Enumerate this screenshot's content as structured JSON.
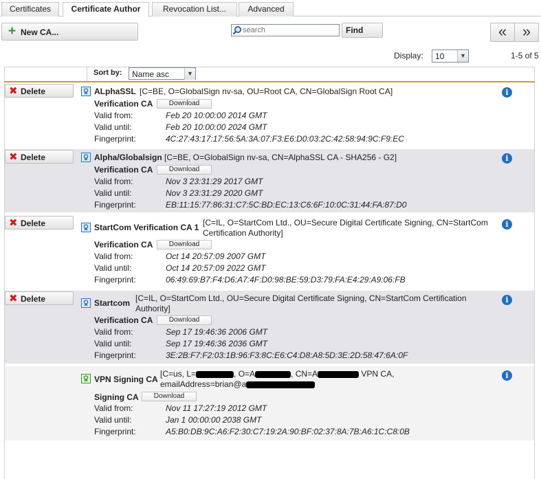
{
  "tabs": [
    {
      "label": "Certificates",
      "active": false
    },
    {
      "label": "Certificate Author",
      "active": true
    },
    {
      "label": "Revocation List...",
      "active": false
    },
    {
      "label": "Advanced",
      "active": false
    }
  ],
  "toolbar": {
    "new_ca_label": "New CA...",
    "search_placeholder": "search",
    "find_label": "Find",
    "prev_label": "«",
    "next_label": "»",
    "display_label": "Display:",
    "display_value": "10",
    "range_label": "1-5 of 5"
  },
  "sort": {
    "label": "Sort by:",
    "value": "Name asc"
  },
  "field_labels": {
    "valid_from": "Valid from:",
    "valid_until": "Valid until:",
    "fingerprint": "Fingerprint:"
  },
  "delete_label": "Delete",
  "download_label": "Download",
  "info_glyph": "i",
  "colors": {
    "accent_line": "#d3963a",
    "delete_red": "#cc1f1f",
    "info_blue": "#1f6fc4",
    "row_shade": "#e4e4e9"
  },
  "certificates": [
    {
      "name": "ALphaSSL",
      "dn": "[C=BE, O=GlobalSign nv-sa, OU=Root CA, CN=GlobalSign Root CA]",
      "type": "Verification CA",
      "valid_from": "Feb 20 10:00:00 2014 GMT",
      "valid_until": "Feb 20 10:00:00 2024 GMT",
      "fingerprint": "4C:27:43:17:17:56:5A:3A:07:F3:E6:D0:03:2C:42:58:94:9C:F9:EC",
      "deletable": true,
      "icon": "certificate-icon"
    },
    {
      "name": "Alpha/Globalsign",
      "dn": "[C=BE, O=GlobalSign nv-sa, CN=AlphaSSL CA - SHA256 - G2]",
      "type": "Verification CA",
      "valid_from": "Nov 3 23:31:29 2017 GMT",
      "valid_until": "Nov 3 23:31:29 2020 GMT",
      "fingerprint": "EB:11:15:77:86:31:C7:5C:BD:EC:13:C6:6F:10:0C:31:44:FA:87:D0",
      "deletable": true,
      "icon": "certificate-icon"
    },
    {
      "name": "StartCom Verification CA 1",
      "dn": "[C=IL, O=StartCom Ltd., OU=Secure Digital Certificate Signing, CN=StartCom Certification Authority]",
      "type": "Verification CA",
      "valid_from": "Oct 14 20:57:09 2007 GMT",
      "valid_until": "Oct 14 20:57:09 2022 GMT",
      "fingerprint": "06:49:69:B7:F4:D6:A7:4F:D0:98:BE:59:D3:79:FA:E4:29:A9:06:FB",
      "deletable": true,
      "icon": "certificate-icon"
    },
    {
      "name": "Startcom",
      "dn": "[C=IL, O=StartCom Ltd., OU=Secure Digital Certificate Signing, CN=StartCom Certification Authority]",
      "type": "Verification CA",
      "valid_from": "Sep 17 19:46:36 2006 GMT",
      "valid_until": "Sep 17 19:46:36 2036 GMT",
      "fingerprint": "3E:2B:F7:F2:03:1B:96:F3:8C:E6:C4:D8:A8:5D:3E:2D:58:47:6A:0F",
      "deletable": true,
      "icon": "certificate-icon"
    },
    {
      "name": "VPN Signing CA",
      "dn_line1_a": "[C=us, L=",
      "dn_line1_b": ", O=A",
      "dn_line1_c": ", CN=A",
      "dn_line1_d": " VPN CA,",
      "dn_line2": "emailAddress=brian@a",
      "type": "Signing CA",
      "valid_from": "Nov 11 17:27:19 2012 GMT",
      "valid_until": "Jan 1 00:00:00 2038 GMT",
      "fingerprint": "A5:B0:DB:9C:A6:F2:30:C7:19:2A:90:BF:02:37:8A:7B:A6:1C:C8:0B",
      "deletable": false,
      "icon": "signing-certificate-icon"
    }
  ]
}
